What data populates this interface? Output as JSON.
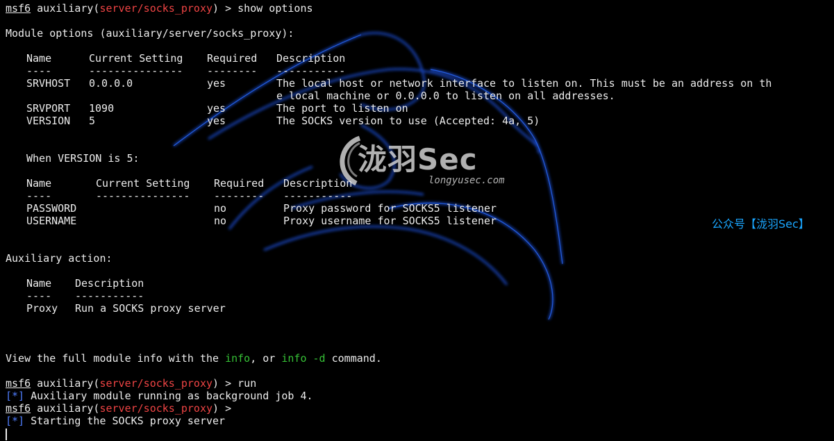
{
  "prompt": {
    "prefix": "msf6",
    "word": " auxiliary(",
    "module": "server/socks_proxy",
    "close": ") > "
  },
  "commands": {
    "show": "show options",
    "run": "run",
    "empty": ""
  },
  "headings": {
    "module_options": "Module options (auxiliary/server/socks_proxy):",
    "when_version": "When VERSION is 5:",
    "aux_action": "Auxiliary action:"
  },
  "options_table": {
    "headers": [
      "Name",
      "Current Setting",
      "Required",
      "Description"
    ],
    "dashes": [
      "----",
      "---------------",
      "--------",
      "-----------"
    ],
    "rows": [
      {
        "name": "SRVHOST",
        "setting": "0.0.0.0",
        "required": "yes",
        "desc": "The local host or network interface to listen on. This must be an address on th",
        "desc2": "e local machine or 0.0.0.0 to listen on all addresses."
      },
      {
        "name": "SRVPORT",
        "setting": "1090",
        "required": "yes",
        "desc": "The port to listen on",
        "desc2": ""
      },
      {
        "name": "VERSION",
        "setting": "5",
        "required": "yes",
        "desc": "The SOCKS version to use (Accepted: 4a, 5)",
        "desc2": ""
      }
    ]
  },
  "v5_table": {
    "headers": [
      "Name",
      "Current Setting",
      "Required",
      "Description"
    ],
    "dashes": [
      "----",
      "---------------",
      "--------",
      "-----------"
    ],
    "rows": [
      {
        "name": "PASSWORD",
        "setting": "",
        "required": "no",
        "desc": "Proxy password for SOCKS5 listener"
      },
      {
        "name": "USERNAME",
        "setting": "",
        "required": "no",
        "desc": "Proxy username for SOCKS5 listener"
      }
    ]
  },
  "action_table": {
    "headers": [
      "Name",
      "Description"
    ],
    "dashes": [
      "----",
      "-----------"
    ],
    "rows": [
      {
        "name": "Proxy",
        "desc": "Run a SOCKS proxy server"
      }
    ]
  },
  "footer": {
    "pre": "View the full module info with the ",
    "cmd1": "info",
    "mid": ", or ",
    "cmd2": "info -d",
    "post": " command."
  },
  "status": {
    "marker": "[*]",
    "line1": " Auxiliary module running as background job 4.",
    "line2": " Starting the SOCKS proxy server"
  },
  "watermark": {
    "title": "泷羽Sec",
    "site": "longyusec.com",
    "public": "公众号【泷羽Sec】"
  },
  "colors": {
    "background": "#000000",
    "text": "#ededed",
    "module": "#ef4444",
    "command": "#36c236",
    "status_marker": "#4f7dfd",
    "dragon": "#1f4fd6",
    "public_account": "#1aa6ff"
  }
}
